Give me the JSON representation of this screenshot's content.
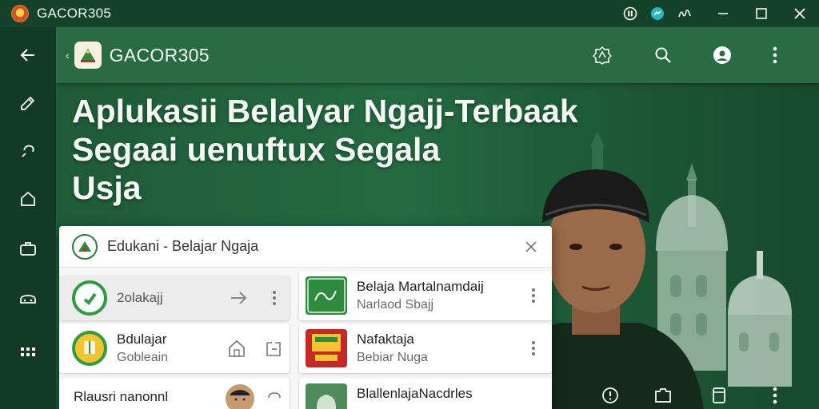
{
  "window": {
    "title": "GACOR305",
    "icons": [
      "pause-icon",
      "messenger-icon",
      "signature-icon",
      "minimize-icon",
      "maximize-icon",
      "close-icon"
    ]
  },
  "rail": {
    "icons": [
      "back-arrow-icon",
      "pencil-icon",
      "hook-icon",
      "home-icon",
      "briefcase-icon",
      "car-icon",
      "apps-grid-icon"
    ]
  },
  "appbar": {
    "brand": "GACOR305",
    "icons": [
      "badge-icon",
      "search-icon",
      "account-icon",
      "more-vert-icon"
    ]
  },
  "hero": {
    "line1": "Aplukasii Belalyar Ngajj-Terbaak",
    "line2": "Segaai uenuftux Segala",
    "line3": "Usja"
  },
  "dialog": {
    "title": "Edukani - Belajar Ngaja",
    "left_items": [
      {
        "title": "2olakajj",
        "subtitle": "",
        "icon": "refresh-circle-icon",
        "action": "arrow-right-icon"
      },
      {
        "title": "Bdulajar",
        "subtitle": "Gobleain",
        "icon": "quran-badge-icon",
        "actions": [
          "house-icon",
          "export-icon"
        ]
      },
      {
        "title": "Rlausri nanonnl",
        "subtitle": "",
        "icon": "avatar",
        "action": "repeat-icon"
      }
    ],
    "right_items": [
      {
        "title": "Belaja Martalnamdaij",
        "subtitle": "Narlaod Sbajj",
        "icon": "calligraphy-icon"
      },
      {
        "title": "Nafaktaja",
        "subtitle": "Bebiar Nuga",
        "icon": "book-cover-icon"
      },
      {
        "title": "BlallenlajaNacdrles",
        "subtitle": "",
        "icon": "mosque-thumb-icon"
      }
    ]
  },
  "bottom_bar": {
    "icons": [
      "info-circle-icon",
      "tab-switch-icon",
      "page-icon",
      "more-vert-icon"
    ]
  },
  "colors": {
    "primary": "#2a6b43",
    "dark": "#14432a",
    "dialog_bg": "#f6f6f6",
    "accent_green": "#2b8a3e"
  }
}
